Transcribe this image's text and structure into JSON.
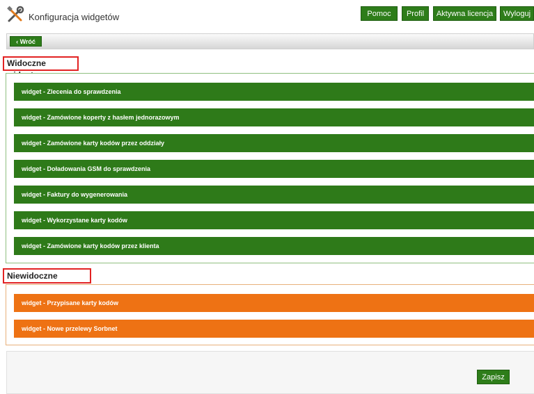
{
  "header": {
    "title": "Konfiguracja widgetów",
    "logo_icon": "tools-icon",
    "buttons": {
      "help": "Pomoc",
      "profile": "Profil",
      "license": "Aktywna licencja",
      "logout": "Wyloguj"
    }
  },
  "toolbar": {
    "back_label": "‹ Wróć"
  },
  "visible_section": {
    "label": "Widoczne widgety",
    "widgets": [
      "widget - Zlecenia do sprawdzenia",
      "widget - Zamówione koperty z hasłem jednorazowym",
      "widget - Zamówione karty kodów przez oddziały",
      "widget - Doładowania GSM do sprawdzenia",
      "widget - Faktury do wygenerowania",
      "widget - Wykorzystane karty kodów",
      "widget - Zamówione karty kodów przez klienta"
    ]
  },
  "hidden_section": {
    "label": "Niewidoczne widgety",
    "widgets": [
      "widget - Przypisane karty kodów",
      "widget - Nowe przelewy Sorbnet"
    ]
  },
  "footer": {
    "save_label": "Zapisz"
  },
  "colors": {
    "primary_green": "#2e7d1a",
    "widget_visible": "#2e7a19",
    "widget_hidden": "#ee7214",
    "highlight_border": "#e22222"
  }
}
